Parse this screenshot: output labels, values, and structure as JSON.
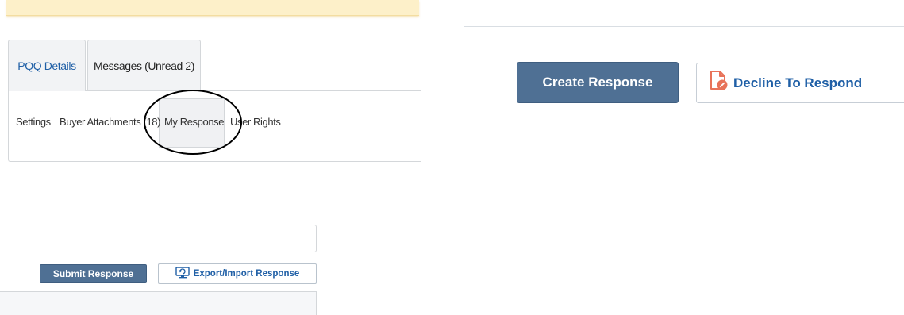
{
  "tabs": [
    {
      "label": "PQQ Details",
      "active": true
    },
    {
      "label": "Messages (Unread 2)",
      "active": false
    }
  ],
  "subnav": {
    "items": [
      "Settings",
      "Buyer Attachments (18)",
      "My Response",
      "User Rights"
    ],
    "selected": "My Response"
  },
  "actions_left": {
    "submit_label": "Submit Response",
    "export_label": "Export/Import Response"
  },
  "actions_right": {
    "create_label": "Create Response",
    "decline_label": "Decline To Respond"
  },
  "colors": {
    "primary_button": "#4f7094",
    "link_blue": "#1f5fa6",
    "alert_yellow": "#fdf0c9",
    "decline_icon": "#e8735a"
  }
}
